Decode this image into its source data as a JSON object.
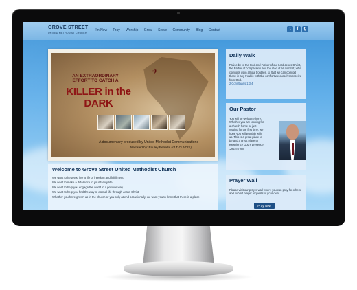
{
  "site": {
    "logo_title": "GROVE STREET",
    "logo_subtitle": "UNITED METHODIST CHURCH",
    "nav": [
      "I'm New",
      "Pray",
      "Worship",
      "Grow",
      "Serve",
      "Community",
      "Blog",
      "Contact"
    ],
    "social_icons": [
      "twitter-icon",
      "facebook-icon",
      "google-plus-icon"
    ],
    "accent_color": "#0e2f55",
    "sky_color": "#63b0ea"
  },
  "slider": {
    "line1": "AN EXTRAORDINARY",
    "line2": "EFFORT TO CATCH A",
    "headline": "KILLER in the DARK",
    "caption": "A documentary produced by United Methodist Communications",
    "narrator": "Narrated by: Pauley Perrette (of TV's NCIS)"
  },
  "welcome": {
    "title": "Welcome to Grove Street United Methodist Church",
    "lines": [
      "We want to help you live a life of freedom and fulfillment.",
      "We want to make a difference in your family life.",
      "We want to help you engage the world in a positive way.",
      "We want to help you find the way to eternal life through Jesus Christ.",
      "Whether you have grown up in the church or you only attend occasionally, we want you to know that there is a place"
    ]
  },
  "daily_walk": {
    "title": "Daily Walk",
    "text": "Praise be to the God and Father of our Lord Jesus Christ, the Father of compassion and the God of all comfort, who comforts us in all our troubles, so that we can comfort those in any trouble with the comfort we ourselves receive from God.",
    "reference": "2 Corinthians 1:3-4"
  },
  "our_pastor": {
    "title": "Our Pastor",
    "lines": [
      "You will be welcome here.",
      "Whether you are looking for",
      "a church home or just",
      "visiting for the first time, we",
      "hope you will worship with",
      "us. This is a great place to",
      "be and a great place to",
      "experience God's presence."
    ],
    "signature": "~Pastor Bill"
  },
  "prayer_wall": {
    "title": "Prayer Wall",
    "text": "Please visit our prayer wall where you can pray for others and submit prayer requests of your own.",
    "button": "Pray Now"
  }
}
